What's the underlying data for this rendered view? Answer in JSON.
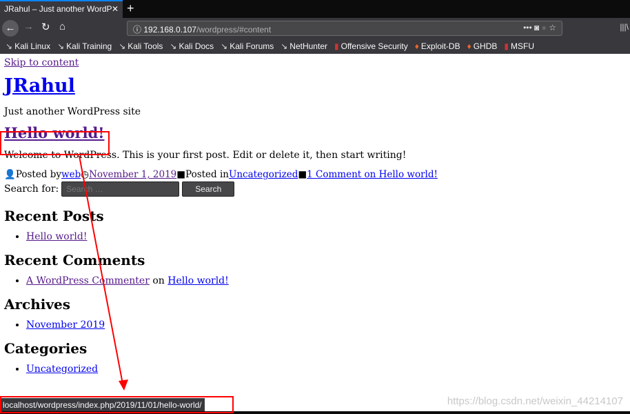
{
  "browser": {
    "tab_title": "JRahul – Just another WordP",
    "url_host": "192.168.0.107",
    "url_path": "/wordpress/#content",
    "bookmarks": [
      "Kali Linux",
      "Kali Training",
      "Kali Tools",
      "Kali Docs",
      "Kali Forums",
      "NetHunter",
      "Offensive Security",
      "Exploit-DB",
      "GHDB",
      "MSFU"
    ]
  },
  "page": {
    "skip": "Skip to content",
    "site_title": "JRahul",
    "tagline": "Just another WordPress site",
    "post": {
      "title": "Hello world!",
      "body": "Welcome to WordPress. This is your first post. Edit or delete it, then start writing!",
      "posted_by": "Posted by",
      "author": "web",
      "date": "November 1, 2019",
      "posted_in": "Posted in",
      "category": "Uncategorized",
      "comments": "1 Comment on Hello world!"
    },
    "search": {
      "label": "Search for:",
      "placeholder": "Search …",
      "button": "Search"
    },
    "widgets": {
      "recent_posts": "Recent Posts",
      "recent_post_item": "Hello world!",
      "recent_comments": "Recent Comments",
      "commenter": "A WordPress Commenter",
      "on": " on ",
      "comment_post": "Hello world!",
      "archives": "Archives",
      "archive_item": "November 2019",
      "categories": "Categories",
      "category_item": "Uncategorized"
    }
  },
  "status_url": "localhost/wordpress/index.php/2019/11/01/hello-world/",
  "watermark": "https://blog.csdn.net/weixin_44214107",
  "annotation_color": "#ff0000"
}
